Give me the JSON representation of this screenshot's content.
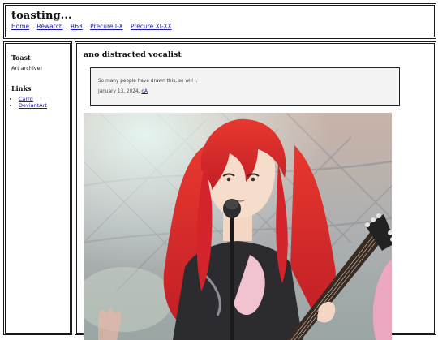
{
  "site": {
    "title": "toasting..."
  },
  "nav": [
    "Home",
    "Rewatch",
    "R63",
    "Precure I-X",
    "Precure XI-XX"
  ],
  "sidebar": {
    "toast_heading": "Toast",
    "toast_desc": "Art archive!",
    "links_heading": "Links",
    "links": [
      "Carrd",
      "DeviantArt"
    ]
  },
  "post": {
    "title": "ano distracted vocalist",
    "text": "So many people have drawn this, so will I.",
    "date": "January 13, 2024,",
    "source_link": "dA"
  },
  "colors": {
    "link": "#1a1aa6",
    "border": "#1a1a1a",
    "post_box_bg": "#f3f3f3"
  }
}
